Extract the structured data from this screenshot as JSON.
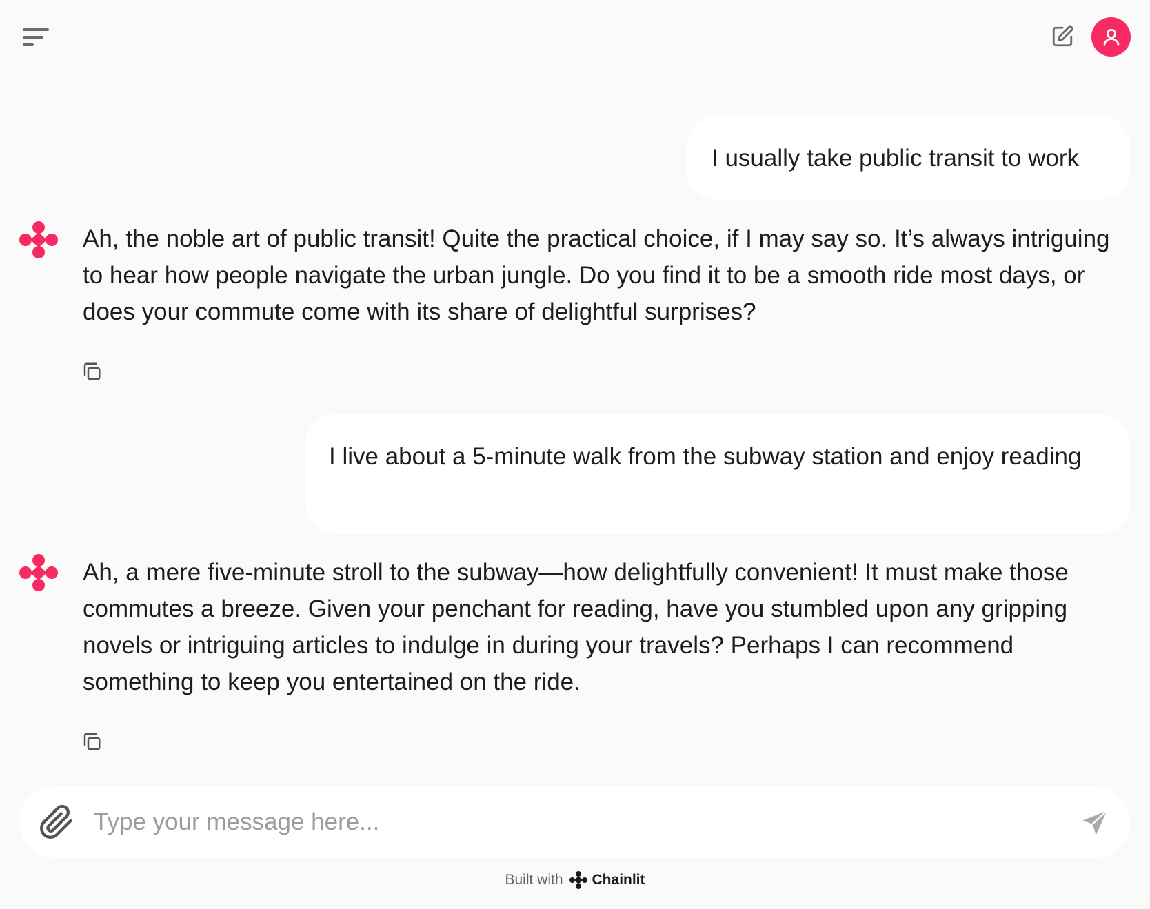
{
  "header": {
    "menu_icon": "sidebar-toggle-icon",
    "new_chat_icon": "edit-icon",
    "user_icon": "user-icon",
    "accent_color": "#f72b63"
  },
  "messages": [
    {
      "role": "user",
      "text": "I usually take public transit to work"
    },
    {
      "role": "assistant",
      "text": "Ah, the noble art of public transit! Quite the practical choice, if I may say so. It’s always intriguing to hear how people navigate the urban jungle. Do you find it to be a smooth ride most days, or does your commute come with its share of delightful surprises?"
    },
    {
      "role": "user",
      "text": "I live about a 5-minute walk from the subway station and enjoy reading"
    },
    {
      "role": "assistant",
      "text": "Ah, a mere five-minute stroll to the subway—how delightfully convenient! It must make those commutes a breeze. Given your penchant for reading, have you stumbled upon any gripping novels or intriguing articles to indulge in during your travels? Perhaps I can recommend something to keep you entertained on the ride."
    }
  ],
  "composer": {
    "placeholder": "Type your message here...",
    "value": "",
    "attach_icon": "paperclip-icon",
    "send_icon": "send-icon"
  },
  "footer": {
    "prefix": "Built with",
    "brand": "Chainlit"
  }
}
